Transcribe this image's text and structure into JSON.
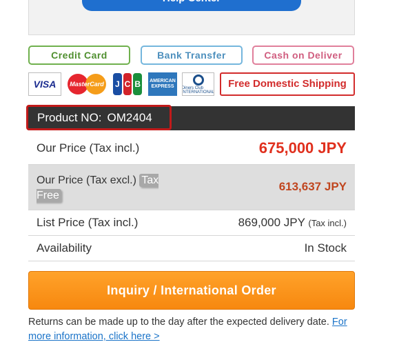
{
  "help": {
    "label": "Help Center"
  },
  "payment_methods": {
    "credit_card": "Credit Card",
    "bank_transfer": "Bank Transfer",
    "cash_on_delivery": "Cash on Deliver"
  },
  "cards": {
    "visa": "VISA",
    "mastercard": "MasterCard",
    "jcb": [
      "J",
      "C",
      "B"
    ],
    "amex": "AMERICAN EXPRESS",
    "diners": "Diners Club INTERNATIONAL"
  },
  "shipping_badge": "Free Domestic Shipping",
  "product": {
    "label": "Product NO:",
    "number": "OM2404"
  },
  "pricing": {
    "our_price_incl_label": "Our Price (Tax incl.)",
    "our_price_incl_value": "675,000 JPY",
    "our_price_excl_label": "Our Price (Tax excl.)",
    "tax_free_badge": "Tax Free",
    "our_price_excl_value": "613,637 JPY",
    "list_price_label": "List Price (Tax incl.)",
    "list_price_value": "869,000 JPY",
    "list_price_note": "(Tax incl.)",
    "availability_label": "Availability",
    "availability_value": "In Stock"
  },
  "order_button": "Inquiry / International Order",
  "returns": {
    "text": "Returns can be made up to the day after the expected delivery date.",
    "link": "For more information, click here >"
  },
  "colors": {
    "price_red": "#e0301e",
    "order_orange": "#f7880f",
    "product_bar": "#333333",
    "highlight_border": "#c21a1a"
  }
}
